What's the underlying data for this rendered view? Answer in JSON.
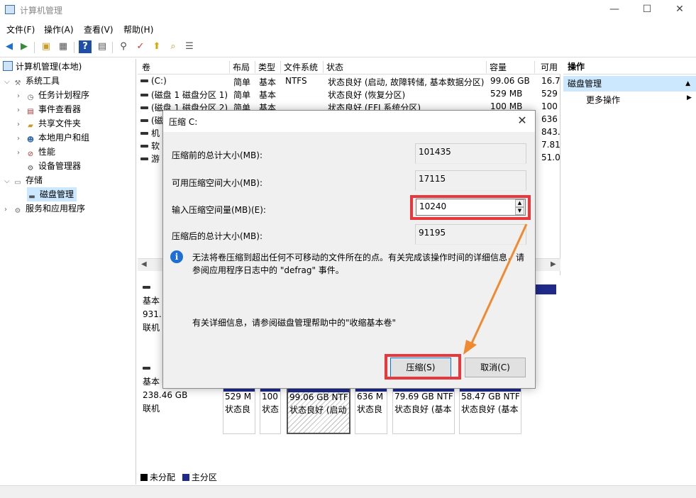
{
  "window": {
    "title": "计算机管理",
    "minimize": "—",
    "maximize": "☐",
    "close": "✕"
  },
  "menu": [
    "文件(F)",
    "操作(A)",
    "查看(V)",
    "帮助(H)"
  ],
  "tree": {
    "root": "计算机管理(本地)",
    "system_tools": "系统工具",
    "task_scheduler": "任务计划程序",
    "event_viewer": "事件查看器",
    "shared_folders": "共享文件夹",
    "local_users": "本地用户和组",
    "performance": "性能",
    "device_manager": "设备管理器",
    "storage": "存储",
    "disk_management": "磁盘管理",
    "services_apps": "服务和应用程序"
  },
  "columns": [
    "卷",
    "布局",
    "类型",
    "文件系统",
    "状态",
    "容量",
    "可用"
  ],
  "volumes": [
    {
      "name": "(C:)",
      "layout": "简单",
      "type": "基本",
      "fs": "NTFS",
      "status": "状态良好 (启动, 故障转储, 基本数据分区)",
      "capacity": "99.06 GB",
      "free": "16.72"
    },
    {
      "name": "(磁盘 1 磁盘分区 1)",
      "layout": "简单",
      "type": "基本",
      "fs": "",
      "status": "状态良好 (恢复分区)",
      "capacity": "529 MB",
      "free": "529"
    },
    {
      "name": "(磁盘 1 磁盘分区 2)",
      "layout": "简单",
      "type": "基本",
      "fs": "",
      "status": "状态良好 (EFI 系统分区)",
      "capacity": "100 MB",
      "free": "100"
    },
    {
      "name": "(磁",
      "layout": "",
      "type": "",
      "fs": "",
      "status": "",
      "capacity": "",
      "free": "636"
    },
    {
      "name": "机",
      "layout": "",
      "type": "",
      "fs": "",
      "status": "",
      "capacity": "",
      "free": "843."
    },
    {
      "name": "软",
      "layout": "",
      "type": "",
      "fs": "",
      "status": "",
      "capacity": "",
      "free": "7.81"
    },
    {
      "name": "游",
      "layout": "",
      "type": "",
      "fs": "",
      "status": "",
      "capacity": "",
      "free": "51.0"
    }
  ],
  "disk0": {
    "type": "基本",
    "size": "931.",
    "state": "联机"
  },
  "disk1": {
    "type": "基本",
    "size": "238.46 GB",
    "state": "联机"
  },
  "partitions": [
    {
      "size": "529 M",
      "status": "状态良"
    },
    {
      "size": "100",
      "status": "状态"
    },
    {
      "size": "99.06 GB NTF",
      "status": "状态良好 (启动"
    },
    {
      "size": "636 M",
      "status": "状态良"
    },
    {
      "size": "79.69 GB NTF",
      "status": "状态良好 (基本"
    },
    {
      "size": "58.47 GB NTF",
      "status": "状态良好 (基本"
    }
  ],
  "legend": {
    "unallocated": "未分配",
    "primary": "主分区"
  },
  "actions": {
    "header": "操作",
    "disk_management": "磁盘管理",
    "more": "更多操作"
  },
  "dialog": {
    "title": "压缩 C:",
    "close": "✕",
    "total_before_label": "压缩前的总计大小(MB):",
    "total_before": "101435",
    "available_label": "可用压缩空间大小(MB):",
    "available": "17115",
    "input_label": "输入压缩空间量(MB)(E):",
    "input_value": "10240",
    "total_after_label": "压缩后的总计大小(MB):",
    "total_after": "91195",
    "info_line1": "无法将卷压缩到超出任何不可移动的文件所在的点。有关完成该操作时间的详细信息，请",
    "info_line2": "参阅应用程序日志中的 \"defrag\" 事件。",
    "detail": "有关详细信息，请参阅磁盘管理帮助中的\"收缩基本卷\"",
    "shrink_button": "压缩(S)",
    "cancel_button": "取消(C)"
  },
  "colors": {
    "highlight": "#e8383d",
    "arrow": "#f08a30",
    "primary_partition": "#1f2a8a",
    "selection": "#cce8ff"
  }
}
